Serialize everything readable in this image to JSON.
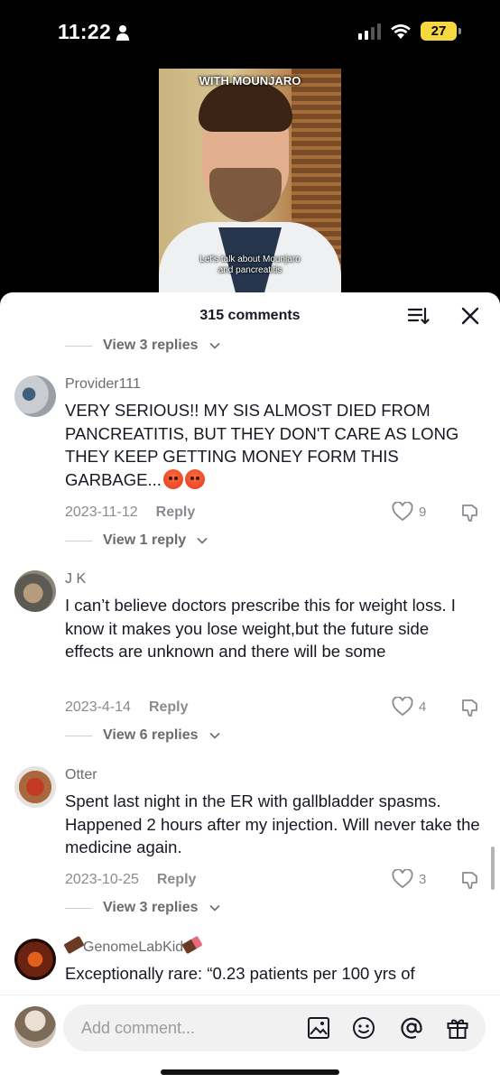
{
  "status": {
    "time": "11:22",
    "battery": "27"
  },
  "video": {
    "caption_top": "WITH MOUNJARO",
    "caption_bottom_1": "Let's talk about Mounjaro",
    "caption_bottom_2": "and pancreatitis"
  },
  "sheet": {
    "title": "315 comments"
  },
  "thread_top": {
    "replies_label": "View 3 replies"
  },
  "comments": [
    {
      "user": "Provider111",
      "text": "VERY SERIOUS!! MY SIS ALMOST DIED FROM PANCREATITIS, BUT THEY DON'T CARE AS LONG THEY KEEP GETTING MONEY FORM THIS GARBAGE...",
      "date": "2023-11-12",
      "reply": "Reply",
      "likes": "9",
      "replies_label": "View 1 reply"
    },
    {
      "user": "J K",
      "text": "I can’t believe doctors prescribe this for weight loss. I know it makes you lose weight,but the future side effects are unknown and there will be some",
      "date": "2023-4-14",
      "reply": "Reply",
      "likes": "4",
      "replies_label": "View 6 replies"
    },
    {
      "user": "Otter",
      "text": "Spent last night in the ER with gallbladder spasms. Happened 2 hours after my injection. Will never take the medicine again.",
      "date": "2023-10-25",
      "reply": "Reply",
      "likes": "3",
      "replies_label": "View 3 replies"
    },
    {
      "user": "GenomeLabKid",
      "text": "Exceptionally rare: “0.23 patients per 100 yrs of"
    }
  ],
  "input": {
    "placeholder": "Add comment..."
  },
  "icons": [
    "person-icon",
    "signal-icon",
    "wifi-icon",
    "battery-icon",
    "sort-icon",
    "close-icon",
    "chevron-down-icon",
    "heart-icon",
    "dislike-icon",
    "image-icon",
    "emoji-icon",
    "mention-icon",
    "gift-icon"
  ]
}
